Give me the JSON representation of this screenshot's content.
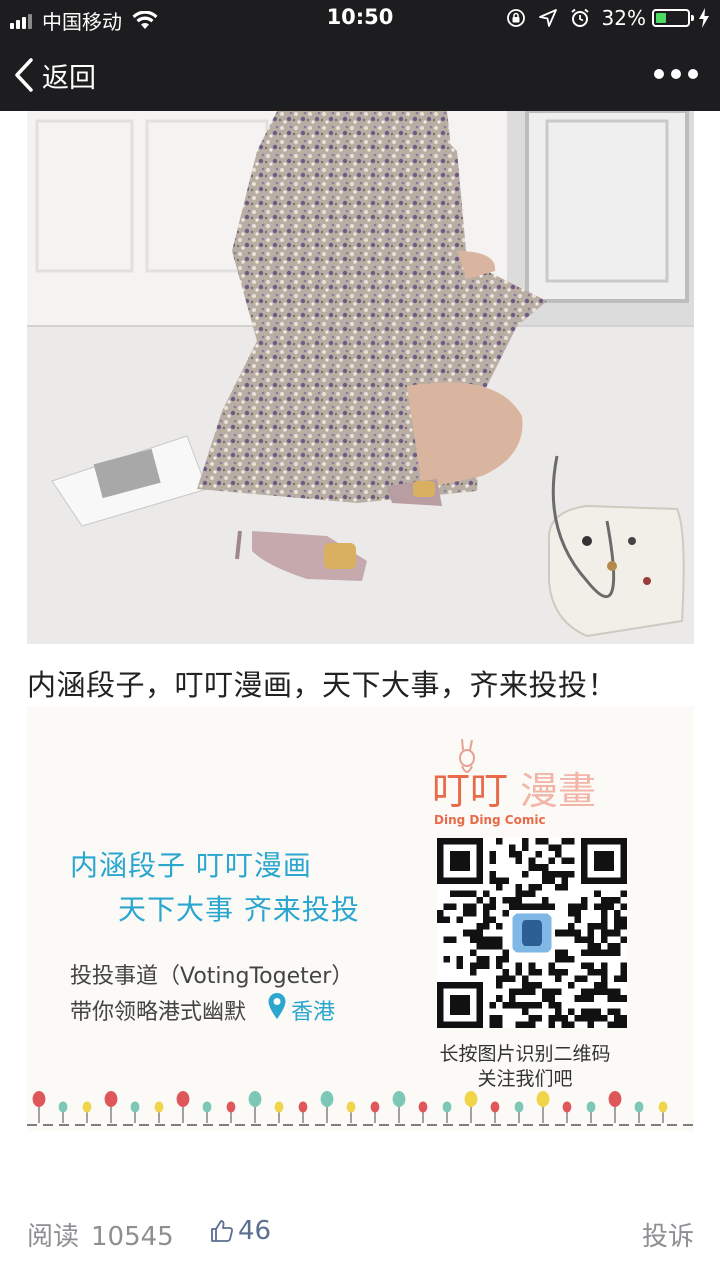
{
  "status_bar": {
    "carrier": "中国移动",
    "time": "10:50",
    "battery_percent": "32%",
    "battery_level": 0.32,
    "icons": [
      "signal-icon",
      "wifi-icon",
      "lock-rotation-icon",
      "location-arrow-icon",
      "alarm-icon",
      "battery-icon",
      "charging-bolt-icon"
    ]
  },
  "nav": {
    "back_label": "返回",
    "more_icon": "more-dots-icon"
  },
  "article": {
    "caption": "内涵段子，叮叮漫画，天下大事，齐来投投！",
    "promo": {
      "slogan_line1": "内涵段子  叮叮漫画",
      "slogan_line2": "天下大事  齐来投投",
      "brand_line1": "投投事道（VotingTogeter）",
      "brand_line2": "带你领略港式幽默",
      "location": "香港",
      "logo_title": "叮叮漫畫",
      "logo_subtitle": "Ding Ding Comic",
      "qr_hint_line1": "长按图片识别二维码",
      "qr_hint_line2": "关注我们吧",
      "accent_color": "#2aa6cf"
    }
  },
  "footer": {
    "read_label": "阅读",
    "read_count": "10545",
    "like_count": "46",
    "report_label": "投诉"
  }
}
